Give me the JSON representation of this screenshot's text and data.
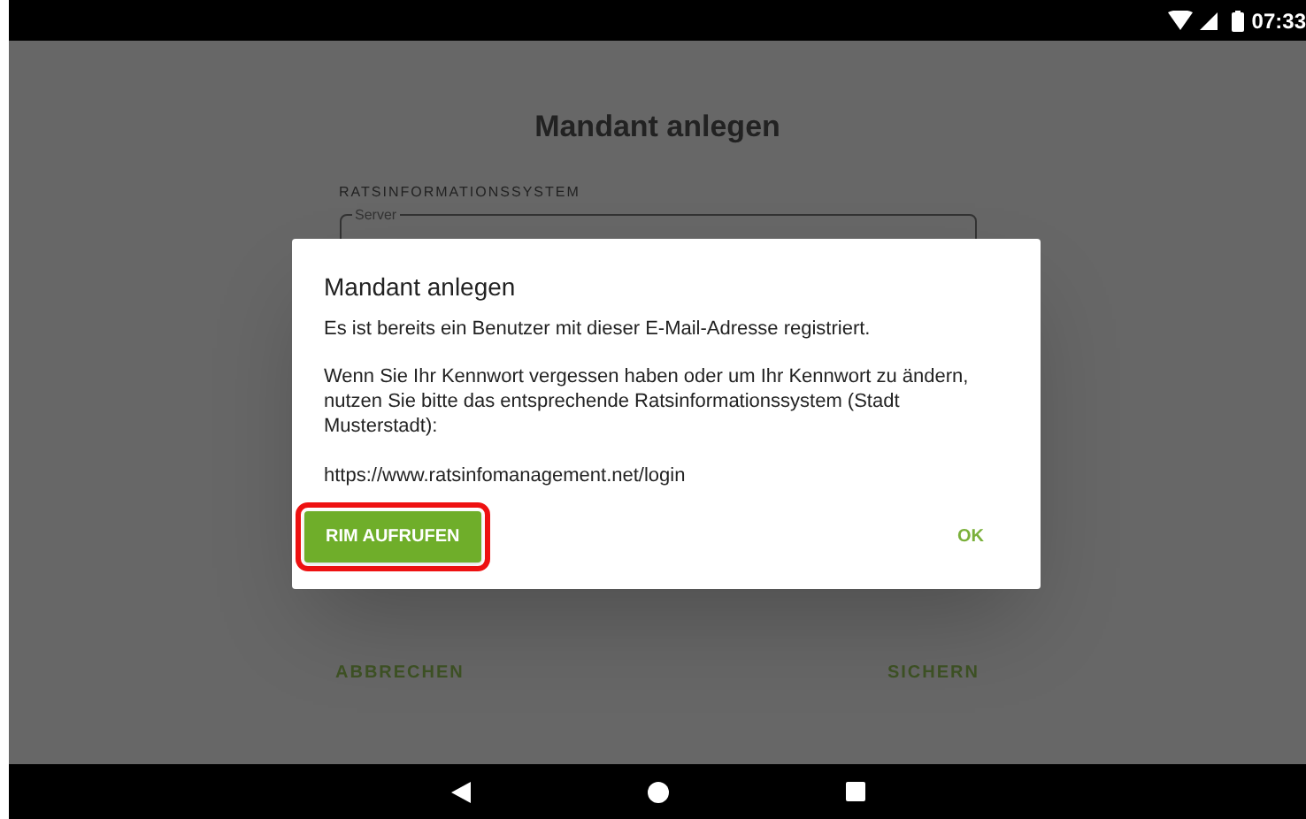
{
  "status_bar": {
    "time": "07:33"
  },
  "page": {
    "title": "Mandant anlegen",
    "section_label": "RATSINFORMATIONSSYSTEM",
    "server_field": {
      "label": "Server"
    },
    "buttons": [
      "ABBRECHEN",
      "SICHERN"
    ]
  },
  "dialog": {
    "title": "Mandant anlegen",
    "message": "Es ist bereits ein Benutzer mit dieser E-Mail-Adresse registriert.",
    "details": "Wenn Sie Ihr Kennwort vergessen haben oder um Ihr Kennwort zu ändern, nutzen Sie bitte das entsprechende Ratsinformationssystem (Stadt Musterstadt):",
    "url": "https://www.ratsinfomanagement.net/login",
    "actions": [
      {
        "label": "RIM AUFRUFEN",
        "kind": "filled",
        "highlighted": true
      },
      {
        "label": "OK",
        "kind": "text",
        "highlighted": false
      }
    ]
  }
}
